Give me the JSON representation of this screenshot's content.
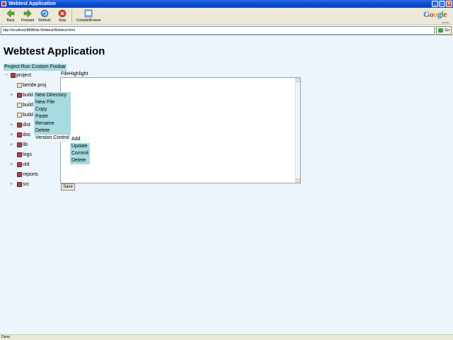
{
  "window": {
    "title": "Webtest Application"
  },
  "toolbar": {
    "back": "Back",
    "forward": "Forward",
    "refresh": "Refresh",
    "stop": "Stop",
    "compile": "CompileBrowse"
  },
  "google": {
    "logo": "Google",
    "sub": "Web Toolkit"
  },
  "address": {
    "url": "http://localhost:8888/de.Webtest/Webtest.html",
    "go": "Go"
  },
  "page": {
    "title": "Webtest Application"
  },
  "menu": {
    "project": "Project",
    "run": "Run",
    "custom": "Custom",
    "foobar": "Foobar"
  },
  "tree": {
    "root": "project",
    "items": [
      "beride.proj",
      "build",
      "build",
      "build",
      "dist",
      "doc",
      "lib",
      "logs",
      "old",
      "reports",
      "src"
    ]
  },
  "context_menu": {
    "items": [
      "New Directory",
      "New File",
      "Copy",
      "Paste",
      "Rename",
      "Delete",
      "Version Control"
    ]
  },
  "submenu": {
    "items": [
      "Add",
      "Update",
      "Commit",
      "Delete"
    ]
  },
  "tabs": {
    "file": "File",
    "highlight": "Highlight"
  },
  "editor": {
    "save": "Save"
  },
  "status": {
    "text": "Done"
  }
}
